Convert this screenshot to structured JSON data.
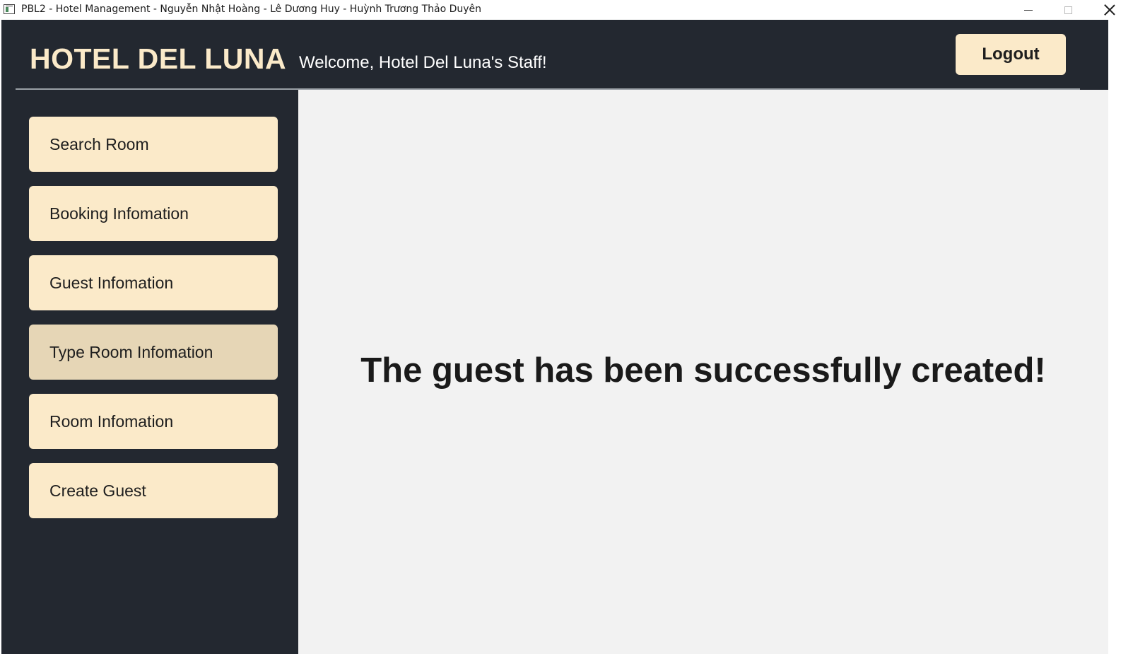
{
  "window": {
    "title": "PBL2 - Hotel Management - Nguyễn Nhật Hoàng - Lê Dương Huy - Huỳnh Trương Thảo Duyên"
  },
  "header": {
    "title": "HOTEL DEL LUNA",
    "welcome": "Welcome, Hotel Del Luna's Staff!",
    "logout_label": "Logout"
  },
  "sidebar": {
    "items": [
      {
        "label": "Search Room",
        "active": false
      },
      {
        "label": "Booking Infomation",
        "active": false
      },
      {
        "label": "Guest Infomation",
        "active": false
      },
      {
        "label": "Type Room Infomation",
        "active": true
      },
      {
        "label": "Room Infomation",
        "active": false
      },
      {
        "label": "Create Guest",
        "active": false
      }
    ]
  },
  "content": {
    "message": "The guest has been successfully created!"
  },
  "colors": {
    "frame_background": "#232830",
    "accent_cream": "#fbeac9",
    "active_item": "#e6d6b6",
    "content_background": "#f2f2f2"
  }
}
